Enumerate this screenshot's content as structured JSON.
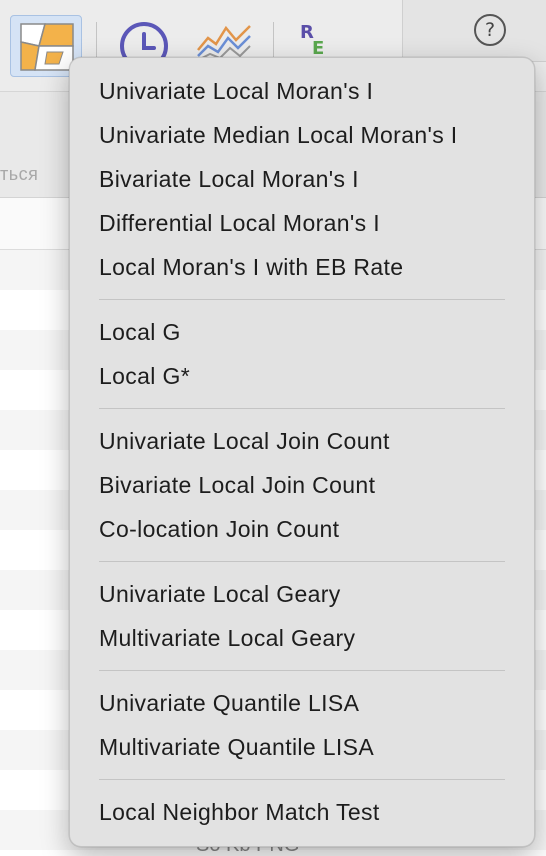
{
  "help_icon": "question-mark-icon",
  "background": {
    "partial_text": "ться",
    "bottom_partial_text": "So Kb   PNG"
  },
  "menu": {
    "groups": [
      {
        "items": [
          {
            "label": "Univariate Local Moran's I"
          },
          {
            "label": "Univariate Median Local Moran's I"
          },
          {
            "label": "Bivariate Local Moran's I"
          },
          {
            "label": "Differential Local Moran's I"
          },
          {
            "label": "Local Moran's I with EB Rate"
          }
        ]
      },
      {
        "items": [
          {
            "label": "Local G"
          },
          {
            "label": "Local G*"
          }
        ]
      },
      {
        "items": [
          {
            "label": "Univariate Local Join Count"
          },
          {
            "label": "Bivariate Local Join Count"
          },
          {
            "label": "Co-location Join Count"
          }
        ]
      },
      {
        "items": [
          {
            "label": "Univariate Local Geary"
          },
          {
            "label": "Multivariate Local Geary"
          }
        ]
      },
      {
        "items": [
          {
            "label": "Univariate Quantile LISA"
          },
          {
            "label": "Multivariate Quantile LISA"
          }
        ]
      },
      {
        "items": [
          {
            "label": "Local Neighbor Match Test"
          }
        ]
      }
    ]
  }
}
